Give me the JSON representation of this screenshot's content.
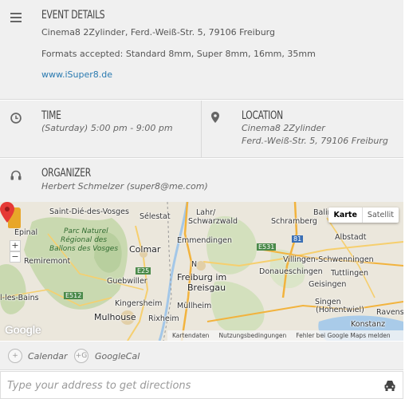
{
  "details": {
    "heading": "EVENT DETAILS",
    "address_line": "Cinema8 2Zylinder, Ferd.-Weiß-Str. 5, 79106 Freiburg",
    "formats_line": "Formats accepted: Standard 8mm, Super 8mm, 16mm, 35mm",
    "link": "www.iSuper8.de"
  },
  "time": {
    "heading": "TIME",
    "value": "(Saturday) 5:00 pm - 9:00 pm"
  },
  "location": {
    "heading": "LOCATION",
    "line1": "Cinema8 2Zylinder",
    "line2": "Ferd.-Weiß-Str. 5, 79106 Freiburg"
  },
  "organizer": {
    "heading": "ORGANIZER",
    "value": "Herbert Schmelzer (super8@me.com)"
  },
  "map": {
    "type_buttons": [
      "Karte",
      "Satellit"
    ],
    "zoom_in": "+",
    "zoom_out": "−",
    "labels": {
      "saint_die": "Saint-Dié-des-Vosges",
      "selestat": "Sélestat",
      "lahr": "Lahr/",
      "schwarzwald": "Schwarzwald",
      "schramberg": "Schramberg",
      "balingen": "Baling",
      "epinal": "Épinal",
      "park1": "Parc Naturel",
      "park2": "Régional des",
      "park3": "Ballons des Vosges",
      "colmar": "Colmar",
      "emmendingen": "Emmendingen",
      "albstadt": "Albstadt",
      "remiremont": "Remiremont",
      "villingen": "Villingen-Schwenningen",
      "guebwiller": "Guebwiller",
      "donaueschingen": "Donaueschingen",
      "tuttlingen": "Tuttlingen",
      "freiburg1": "Freiburg im",
      "freiburg2": "Breisgau",
      "geisingen": "Geisingen",
      "les_bains": "l-les-Bains",
      "kingersheim": "Kingersheim",
      "mullheim": "Müllheim",
      "singen": "Singen",
      "hohentwiel": "(Hohentwiel)",
      "mulhouse": "Mulhouse",
      "rixheim": "Rixheim",
      "ravens": "Ravens",
      "konstanz": "Konstanz",
      "road_e25": "E25",
      "road_e512": "E512",
      "road_a81": "81",
      "road_e531": "E531",
      "road_n": "N"
    },
    "footer": {
      "kartendaten": "Kartendaten",
      "nutzung": "Nutzungsbedingungen",
      "fehler": "Fehler bei Google Maps melden"
    },
    "logo": "Google"
  },
  "calendar": {
    "calendar_icon": "+",
    "calendar_label": "Calendar",
    "gcal_icon": "+G",
    "gcal_label": "GoogleCal"
  },
  "directions": {
    "placeholder": "Type your address to get directions"
  },
  "colors": {
    "panel_bg": "#f0f0f0",
    "link": "#2a7ab0",
    "pin": "#e53935"
  }
}
